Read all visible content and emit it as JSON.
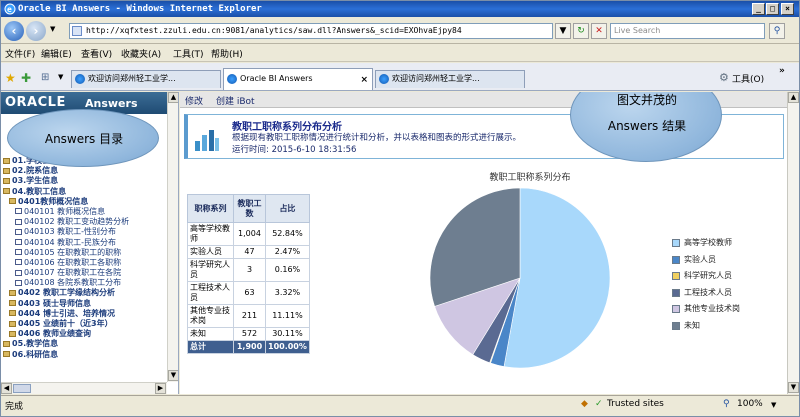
{
  "window": {
    "title": "Oracle BI Answers - Windows Internet Explorer",
    "controls": [
      "_",
      "□",
      "×"
    ]
  },
  "address": {
    "url": "http://xqfxtest.zzuli.edu.cn:9081/analytics/saw.dll?Answers&_scid=EXOhvaEjpy84",
    "search_placeholder": "Live Search"
  },
  "menu": [
    "文件(F)",
    "编辑(E)",
    "查看(V)",
    "收藏夹(A)",
    "工具(T)",
    "帮助(H)"
  ],
  "tabs": [
    {
      "label": "欢迎访问郑州轻工业学...",
      "active": false
    },
    {
      "label": "Oracle BI Answers",
      "active": true,
      "close": "×"
    },
    {
      "label": "欢迎访问郑州轻工业学...",
      "active": false
    }
  ],
  "toolbar_right": {
    "tools_label": "工具(O)",
    "more": "»"
  },
  "sidebar": {
    "brand": "ORACLE",
    "app": "Answers",
    "tree": [
      {
        "label": "01.学校基本信息",
        "type": "folder",
        "level": 0,
        "bold": true
      },
      {
        "label": "02.院系信息",
        "type": "folder",
        "level": 0,
        "bold": true
      },
      {
        "label": "03.学生信息",
        "type": "folder",
        "level": 0,
        "bold": true
      },
      {
        "label": "04.教职工信息",
        "type": "folder",
        "level": 0,
        "bold": true
      },
      {
        "label": "0401教师概况信息",
        "type": "folder",
        "level": 1,
        "bold": true
      },
      {
        "label": "040101 教师概况信息",
        "type": "doc",
        "level": 2,
        "bold": false
      },
      {
        "label": "040102 教职工变动趋势分析",
        "type": "doc",
        "level": 2,
        "bold": false
      },
      {
        "label": "040103 教职工-性别分布",
        "type": "doc",
        "level": 2,
        "bold": false
      },
      {
        "label": "040104 教职工-民族分布",
        "type": "doc",
        "level": 2,
        "bold": false
      },
      {
        "label": "040105 在职教职工的职称",
        "type": "doc",
        "level": 2,
        "bold": false
      },
      {
        "label": "040106 在职教职工各职称",
        "type": "doc",
        "level": 2,
        "bold": false
      },
      {
        "label": "040107 在职教职工在各院",
        "type": "doc",
        "level": 2,
        "bold": false
      },
      {
        "label": "040108 各院系教职工分布",
        "type": "doc",
        "level": 2,
        "bold": false
      },
      {
        "label": "0402 教职工学缘结构分析",
        "type": "folder",
        "level": 1,
        "bold": true
      },
      {
        "label": "0403 硕士导师信息",
        "type": "folder",
        "level": 1,
        "bold": true
      },
      {
        "label": "0404 博士引进、培养情况",
        "type": "folder",
        "level": 1,
        "bold": true
      },
      {
        "label": "0405 业绩前十（近3年）",
        "type": "folder",
        "level": 1,
        "bold": true
      },
      {
        "label": "0406 教师业绩查询",
        "type": "folder",
        "level": 1,
        "bold": true
      },
      {
        "label": "05.教学信息",
        "type": "folder",
        "level": 0,
        "bold": true
      },
      {
        "label": "06.科研信息",
        "type": "folder",
        "level": 0,
        "bold": true
      }
    ]
  },
  "main_toolbar": {
    "modify": "修改",
    "create": "创建 iBot"
  },
  "report": {
    "title": "教职工职称系列分布分析",
    "description": "根据现有教职工职称情况进行统计和分析，并以表格和图表的形式进行展示。",
    "runtime": "运行时间: 2015-6-10 18:31:56"
  },
  "table": {
    "headers": [
      "职称系列",
      "教职工数",
      "占比"
    ],
    "rows": [
      [
        "高等学校教师",
        "1,004",
        "52.84%"
      ],
      [
        "实验人员",
        "47",
        "2.47%"
      ],
      [
        "科学研究人员",
        "3",
        "0.16%"
      ],
      [
        "工程技术人员",
        "63",
        "3.32%"
      ],
      [
        "其他专业技术岗",
        "211",
        "11.11%"
      ],
      [
        "未知",
        "572",
        "30.11%"
      ]
    ],
    "total": [
      "总计",
      "1,900",
      "100.00%"
    ]
  },
  "chart_data": {
    "type": "pie",
    "title": "教职工职称系列分布",
    "categories": [
      "高等学校教师",
      "实验人员",
      "科学研究人员",
      "工程技术人员",
      "其他专业技术岗",
      "未知"
    ],
    "values": [
      1004,
      47,
      3,
      63,
      211,
      572
    ],
    "colors": [
      "#a8d8fb",
      "#4a86c8",
      "#f0d060",
      "#5a6a92",
      "#cfc6e2",
      "#6e7e90"
    ],
    "legend_position": "right"
  },
  "callouts": {
    "left": "Answers 目录",
    "right_line1": "图文并茂的",
    "right_line2": "Answers 结果"
  },
  "status": {
    "left": "完成",
    "zone": "Trusted sites",
    "zoom": "100%"
  }
}
